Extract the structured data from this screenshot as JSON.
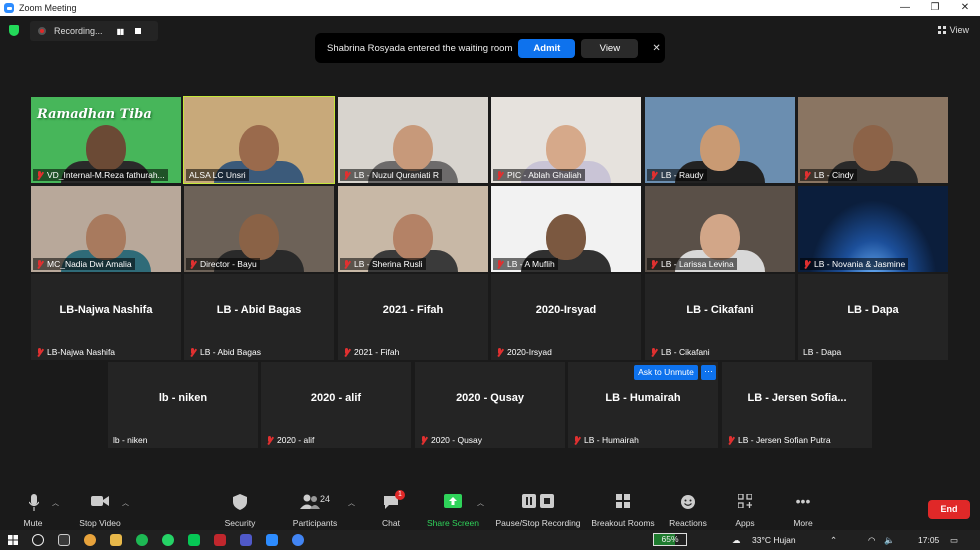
{
  "window": {
    "title": "Zoom Meeting",
    "controls": [
      "—",
      "❐",
      "✕"
    ]
  },
  "top": {
    "recording_label": "Recording...",
    "view_label": "View",
    "notification": {
      "message": "Shabrina Rosyada entered the waiting room",
      "admit_label": "Admit",
      "view_label": "View"
    }
  },
  "colors": {
    "accent": "#0e72ed",
    "muted_mic": "#e03030",
    "active_speaker": "#c5e63a",
    "end": "#e02828",
    "share": "#2fd35a"
  },
  "tiles": [
    {
      "label": "VD_Internal-M.Reza fathurah...",
      "video": true,
      "muted": true,
      "bg": "#47b65a",
      "skin": "#6b4a35",
      "shirt": "#2a2a2a",
      "overlay_text": "Ramadhan Tiba"
    },
    {
      "label": "ALSA LC Unsri",
      "video": true,
      "muted": false,
      "bg": "#c8a97a",
      "skin": "#9a6a4c",
      "shirt": "#3b5a7a",
      "active": true
    },
    {
      "label": "LB - Nuzul Quraniati R",
      "video": true,
      "muted": true,
      "bg": "#d8d4ce",
      "skin": "#c7997a",
      "shirt": "#6d6b6b"
    },
    {
      "label": "PIC - Ablah Ghaliah",
      "video": true,
      "muted": true,
      "bg": "#e6e2dd",
      "skin": "#d6a98a",
      "shirt": "#c9c4d6"
    },
    {
      "label": "LB - Raudy",
      "video": true,
      "muted": true,
      "bg": "#6b8eb0",
      "skin": "#c99a73",
      "shirt": "#222222"
    },
    {
      "label": "LB - Cindy",
      "video": true,
      "muted": true,
      "bg": "#8a7562",
      "skin": "#8c6348",
      "shirt": "#2a2a2a"
    },
    {
      "label": "MC_Nadia Dwi Amalia",
      "video": true,
      "muted": true,
      "bg": "#b8a89a",
      "skin": "#a87a5e",
      "shirt": "#2f6b78"
    },
    {
      "label": "Director - Bayu",
      "video": true,
      "muted": true,
      "bg": "#6d6258",
      "skin": "#8a6246",
      "shirt": "#2a2a2a"
    },
    {
      "label": "LB - Sherina Rusli",
      "video": true,
      "muted": true,
      "bg": "#c8b8a6",
      "skin": "#b48266",
      "shirt": "#3a3a3a"
    },
    {
      "label": "LB - A Muflih",
      "video": true,
      "muted": true,
      "bg": "#f2f2f2",
      "skin": "#7b5840",
      "shirt": "#303030"
    },
    {
      "label": "LB - Larissa Levina",
      "video": true,
      "muted": true,
      "bg": "#5a5048",
      "skin": "#d2a688",
      "shirt": "#d8d8d8"
    },
    {
      "label": "LB - Novania & Jasmine",
      "video": true,
      "muted": true,
      "bg": "#0b1e3c",
      "skin": "",
      "shirt": ""
    },
    {
      "name": "LB-Najwa Nashifa",
      "label": "LB-Najwa Nashifa",
      "video": false,
      "muted": true
    },
    {
      "name": "LB - Abid Bagas",
      "label": "LB - Abid Bagas",
      "video": false,
      "muted": true
    },
    {
      "name": "2021 - Fifah",
      "label": "2021 - Fifah",
      "video": false,
      "muted": true
    },
    {
      "name": "2020-Irsyad",
      "label": "2020-Irsyad",
      "video": false,
      "muted": true
    },
    {
      "name": "LB - Cikafani",
      "label": "LB - Cikafani",
      "video": false,
      "muted": true
    },
    {
      "name": "LB - Dapa",
      "label": "LB - Dapa",
      "video": false,
      "muted": false
    },
    {
      "name": "lb - niken",
      "label": "lb - niken",
      "video": false,
      "muted": false
    },
    {
      "name": "2020 - alif",
      "label": "2020 - alif",
      "video": false,
      "muted": true
    },
    {
      "name": "2020 - Qusay",
      "label": "2020 - Qusay",
      "video": false,
      "muted": true
    },
    {
      "name": "LB - Humairah",
      "label": "LB - Humairah",
      "video": false,
      "muted": true
    },
    {
      "name": "LB - Jersen Sofia...",
      "label": "LB - Jersen Sofian Putra",
      "video": false,
      "muted": true
    }
  ],
  "hover": {
    "ask_to_unmute": "Ask to Unmute",
    "more": "···"
  },
  "toolbar": {
    "mute": "Mute",
    "stop_video": "Stop Video",
    "security": "Security",
    "participants": "Participants",
    "participants_count": "24",
    "chat": "Chat",
    "chat_badge": "1",
    "share_screen": "Share Screen",
    "recording": "Pause/Stop Recording",
    "breakout": "Breakout Rooms",
    "reactions": "Reactions",
    "apps": "Apps",
    "more": "More",
    "end": "End"
  },
  "taskbar": {
    "battery": "65%",
    "battery_level": 0.65,
    "weather": "33°C  Hujan",
    "time": "17:05"
  }
}
